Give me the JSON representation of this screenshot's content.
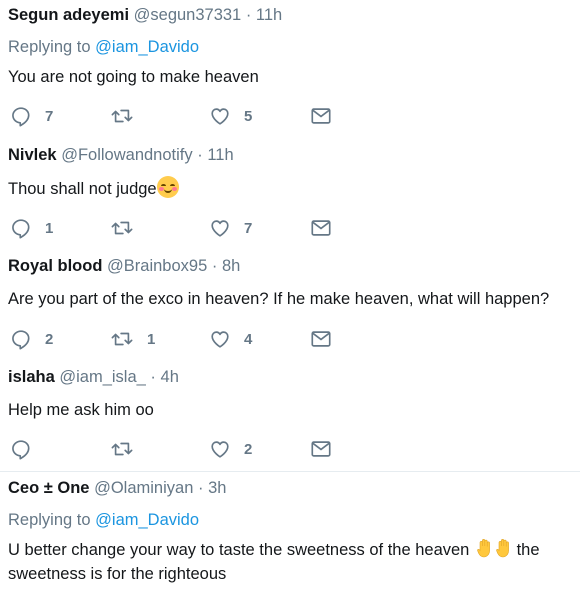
{
  "icons": {
    "reply": "reply-icon",
    "retweet": "retweet-icon",
    "like": "heart-icon",
    "dm": "envelope-icon"
  },
  "colors": {
    "text": "#14171a",
    "muted": "#657786",
    "link": "#1b95e0",
    "divider": "#e6ecf0"
  },
  "tweets": [
    {
      "name": "Segun adeyemi",
      "handle": "@segun37331",
      "dot": "·",
      "time": "11h",
      "replying_label": "Replying to",
      "replying_to": "@iam_Davido",
      "text": "You are not going to make heaven",
      "replies": "7",
      "retweets": "",
      "likes": "5"
    },
    {
      "name": "Nivlek",
      "handle": "@Followandnotify",
      "dot": "·",
      "time": "11h",
      "text": "Thou shall not judge",
      "emoji": "smiling-face-with-blush-icon",
      "replies": "1",
      "retweets": "",
      "likes": "7"
    },
    {
      "name": "Royal blood",
      "handle": "@Brainbox95",
      "dot": "·",
      "time": "8h",
      "text": "Are you part of the exco in heaven? If he make heaven, what will happen?",
      "replies": "2",
      "retweets": "1",
      "likes": "4"
    },
    {
      "name": "islaha",
      "handle": "@iam_isla_",
      "dot": "·",
      "time": "4h",
      "text": "Help me ask him oo",
      "replies": "",
      "retweets": "",
      "likes": "2"
    },
    {
      "name": "Ceo ± One",
      "handle": "@Olaminiyan",
      "dot": "·",
      "time": "3h",
      "replying_label": "Replying to",
      "replying_to": "@iam_Davido",
      "text_before": "U better change your way to taste the sweetness of the heaven",
      "emoji": "raised-hand-icon",
      "text_after": "the sweetness is for the righteous"
    }
  ]
}
